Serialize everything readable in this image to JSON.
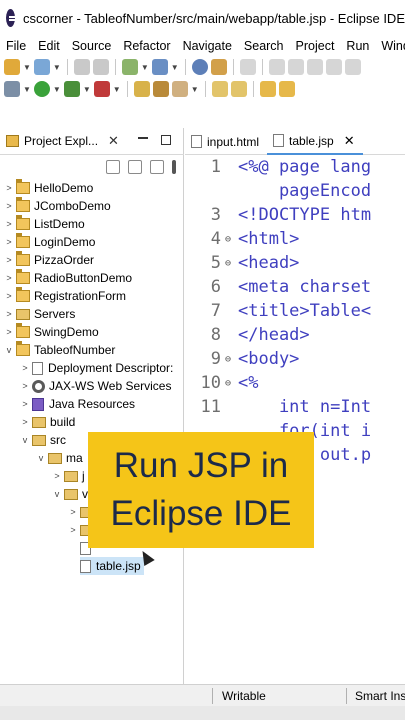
{
  "window": {
    "title": "cscorner - TableofNumber/src/main/webapp/table.jsp - Eclipse IDE"
  },
  "menu": [
    "File",
    "Edit",
    "Source",
    "Refactor",
    "Navigate",
    "Search",
    "Project",
    "Run",
    "Windo"
  ],
  "project_explorer": {
    "tab_label": "Project Expl...",
    "items": [
      {
        "label": "HelloDemo"
      },
      {
        "label": "JComboDemo"
      },
      {
        "label": "ListDemo"
      },
      {
        "label": "LoginDemo"
      },
      {
        "label": "PizzaOrder"
      },
      {
        "label": "RadioButtonDemo"
      },
      {
        "label": "RegistrationForm"
      },
      {
        "label": "Servers"
      },
      {
        "label": "SwingDemo"
      },
      {
        "label": "TableofNumber"
      },
      {
        "label": "Deployment Descriptor:"
      },
      {
        "label": "JAX-WS Web Services"
      },
      {
        "label": "Java Resources"
      },
      {
        "label": "build"
      },
      {
        "label": "src"
      },
      {
        "label": "ma"
      },
      {
        "label": "j"
      },
      {
        "label": "v"
      },
      {
        "label": ""
      },
      {
        "label": ""
      },
      {
        "label": ""
      },
      {
        "label": "table.jsp"
      }
    ]
  },
  "editor": {
    "tabs": [
      {
        "label": "input.html"
      },
      {
        "label": "table.jsp"
      }
    ],
    "lines": [
      {
        "num": "1",
        "text": "<%@ page lang"
      },
      {
        "num": "",
        "text": "    pageEncod"
      },
      {
        "num": "3",
        "text": "<!DOCTYPE htm"
      },
      {
        "num": "4",
        "text": "<html>"
      },
      {
        "num": "5",
        "text": "<head>"
      },
      {
        "num": "6",
        "text": "<meta charset"
      },
      {
        "num": "7",
        "text": "<title>Table<"
      },
      {
        "num": "8",
        "text": "</head>"
      },
      {
        "num": "9",
        "text": "<body>"
      },
      {
        "num": "10",
        "text": "<%"
      },
      {
        "num": "11",
        "text": "    int n=Int"
      },
      {
        "num": "",
        "text": "    for(int i"
      },
      {
        "num": "",
        "text": "        out.p"
      },
      {
        "num": "",
        "text": ""
      },
      {
        "num": "",
        "text": "    >"
      },
      {
        "num": "",
        "text": "    >"
      }
    ]
  },
  "overlay": {
    "line1": "Run JSP in",
    "line2": "Eclipse IDE"
  },
  "status": {
    "writable": "Writable",
    "insert_mode": "Smart Ins"
  },
  "colors": {
    "caption_bg": "#f5c518",
    "keyword": "#7f0055",
    "tag": "#3f7f7f"
  }
}
